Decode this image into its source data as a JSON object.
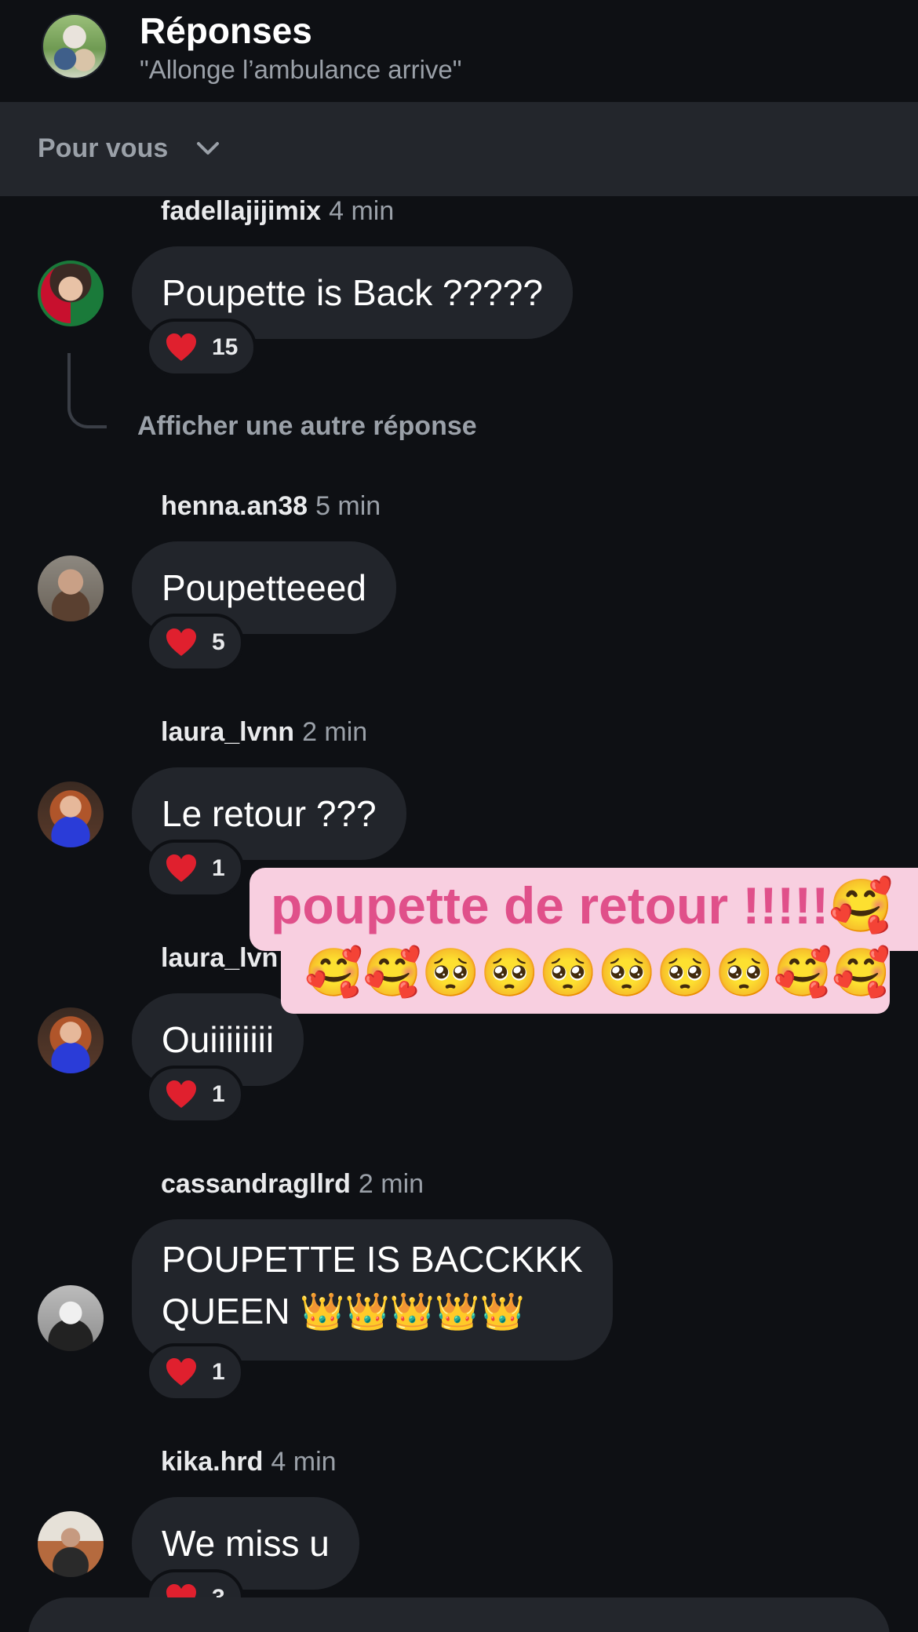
{
  "header": {
    "title": "Réponses",
    "subtitle": "\"Allonge l’ambulance arrive\""
  },
  "filter": {
    "label": "Pour vous"
  },
  "more_replies": "Afficher une autre réponse",
  "comments": [
    {
      "user": "fadellajijimix",
      "time": "4 min",
      "text": "Poupette is Back ?????",
      "likes": "15"
    },
    {
      "user": "henna.an38",
      "time": "5 min",
      "text": "Poupetteeed",
      "likes": "5"
    },
    {
      "user": "laura_lvnn",
      "time": "2 min",
      "text": "Le retour ???",
      "likes": "1"
    },
    {
      "user": "laura_lvn",
      "time": "",
      "text": "Ouiiiiiiii",
      "likes": "1"
    },
    {
      "user": "cassandragllrd",
      "time": "2 min",
      "text_line1": "POUPETTE IS BACCKKK",
      "text_line2": "QUEEN 👑👑👑👑👑",
      "likes": "1"
    },
    {
      "user": "kika.hrd",
      "time": "4 min",
      "text": "We miss u",
      "likes": "3"
    }
  ],
  "overlay": {
    "line1": "poupette de retour !!!!!🥰",
    "line2": "🥰🥰🥺🥺🥺🥺🥺🥺🥰🥰"
  },
  "colors": {
    "background": "#0e1014",
    "bubble": "#22252b",
    "overlay_bg": "#f8cfe0",
    "overlay_text": "#e0508a",
    "heart": "#e0202e"
  },
  "icons": {
    "filter": "chevron-down-icon",
    "reaction": "heart-icon"
  }
}
